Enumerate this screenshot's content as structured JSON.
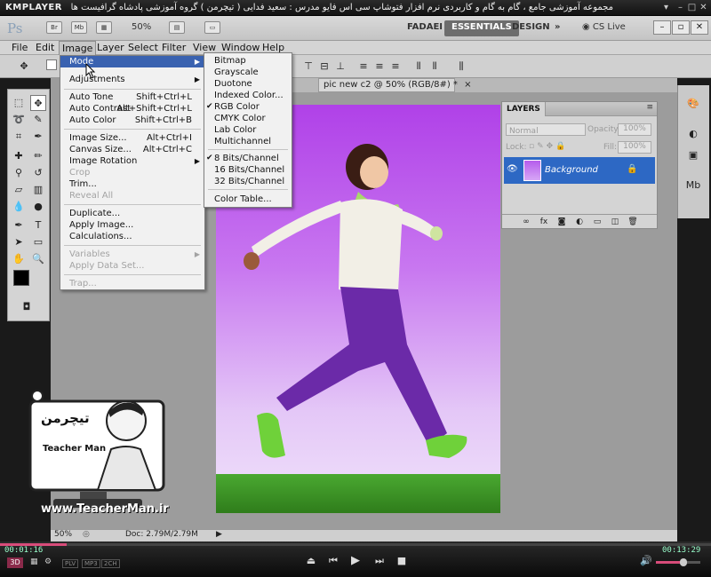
{
  "player": {
    "logo": "KMPLAYER",
    "caption": "مجموعه آموزشی جامع ، گام به گام و کاربردی نرم افزار فتوشاپ سی اس فایو   مدرس : سعید فدایی ( تیچرمن ) گروه آموزشی پادشاه گرافیست ها",
    "time_elapsed": "00:01:16",
    "time_total": "00:13:29",
    "progress_fraction": 0.094,
    "badges": [
      "3D",
      "PLV",
      "MP3",
      "2CH"
    ]
  },
  "app_bar": {
    "logo": "Ps",
    "icons": [
      "Br",
      "Mb"
    ],
    "zoom": "50%",
    "workspaces": [
      "FADAEI",
      "ESSENTIALS",
      "DESIGN"
    ],
    "overflow": "»",
    "cs_live": "CS Live"
  },
  "menu_bar": {
    "items": [
      "File",
      "Edit",
      "Image",
      "Layer",
      "Select",
      "Filter",
      "View",
      "Window",
      "Help"
    ]
  },
  "document_tab": {
    "label": "pic new c2 @ 50% (RGB/8#) *"
  },
  "image_menu": {
    "items": [
      {
        "label": "Mode",
        "shortcut": "",
        "submenu": true,
        "highlighted": true,
        "disabled": false
      },
      {
        "label": "Adjustments",
        "shortcut": "",
        "submenu": true,
        "highlighted": false,
        "disabled": false
      },
      {
        "label": "Auto Tone",
        "shortcut": "Shift+Ctrl+L",
        "submenu": false,
        "highlighted": false,
        "disabled": false
      },
      {
        "label": "Auto Contrast",
        "shortcut": "Alt+Shift+Ctrl+L",
        "submenu": false,
        "highlighted": false,
        "disabled": false
      },
      {
        "label": "Auto Color",
        "shortcut": "Shift+Ctrl+B",
        "submenu": false,
        "highlighted": false,
        "disabled": false
      },
      {
        "label": "Image Size...",
        "shortcut": "Alt+Ctrl+I",
        "submenu": false,
        "highlighted": false,
        "disabled": false
      },
      {
        "label": "Canvas Size...",
        "shortcut": "Alt+Ctrl+C",
        "submenu": false,
        "highlighted": false,
        "disabled": false
      },
      {
        "label": "Image Rotation",
        "shortcut": "",
        "submenu": true,
        "highlighted": false,
        "disabled": false
      },
      {
        "label": "Crop",
        "shortcut": "",
        "submenu": false,
        "highlighted": false,
        "disabled": true
      },
      {
        "label": "Trim...",
        "shortcut": "",
        "submenu": false,
        "highlighted": false,
        "disabled": false
      },
      {
        "label": "Reveal All",
        "shortcut": "",
        "submenu": false,
        "highlighted": false,
        "disabled": true
      },
      {
        "label": "Duplicate...",
        "shortcut": "",
        "submenu": false,
        "highlighted": false,
        "disabled": false
      },
      {
        "label": "Apply Image...",
        "shortcut": "",
        "submenu": false,
        "highlighted": false,
        "disabled": false
      },
      {
        "label": "Calculations...",
        "shortcut": "",
        "submenu": false,
        "highlighted": false,
        "disabled": false
      },
      {
        "label": "Variables",
        "shortcut": "",
        "submenu": true,
        "highlighted": false,
        "disabled": true
      },
      {
        "label": "Apply Data Set...",
        "shortcut": "",
        "submenu": false,
        "highlighted": false,
        "disabled": true
      },
      {
        "label": "Trap...",
        "shortcut": "",
        "submenu": false,
        "highlighted": false,
        "disabled": true
      }
    ]
  },
  "mode_menu": {
    "items": [
      {
        "label": "Bitmap",
        "checked": false,
        "disabled": true
      },
      {
        "label": "Grayscale",
        "checked": false,
        "disabled": false
      },
      {
        "label": "Duotone",
        "checked": false,
        "disabled": true
      },
      {
        "label": "Indexed Color...",
        "checked": false,
        "disabled": false
      },
      {
        "label": "RGB Color",
        "checked": true,
        "disabled": false
      },
      {
        "label": "CMYK Color",
        "checked": false,
        "disabled": false
      },
      {
        "label": "Lab Color",
        "checked": false,
        "disabled": false
      },
      {
        "label": "Multichannel",
        "checked": false,
        "disabled": false
      },
      {
        "label": "8 Bits/Channel",
        "checked": true,
        "disabled": false
      },
      {
        "label": "16 Bits/Channel",
        "checked": false,
        "disabled": false
      },
      {
        "label": "32 Bits/Channel",
        "checked": false,
        "disabled": false
      },
      {
        "label": "Color Table...",
        "checked": false,
        "disabled": true
      }
    ]
  },
  "layers_panel": {
    "title": "LAYERS",
    "blend_mode": "Normal",
    "opacity_label": "Opacity:",
    "opacity_value": "100%",
    "lock_label": "Lock:",
    "fill_label": "Fill:",
    "fill_value": "100%",
    "layer_name": "Background"
  },
  "status_bar": {
    "zoom": "50%",
    "doc_info": "Doc: 2.79M/2.79M"
  },
  "watermark": {
    "brand_fa": "تیچرمن",
    "brand_en": "Teacher Man",
    "url": "www.TeacherMan.ir"
  },
  "colors": {
    "accent_highlight": "#3a62b0",
    "canvas_top": "#b041e8",
    "canvas_bottom": "#f0e2fb",
    "grass": "#3f9a28",
    "layer_selected": "#2d68c4"
  }
}
